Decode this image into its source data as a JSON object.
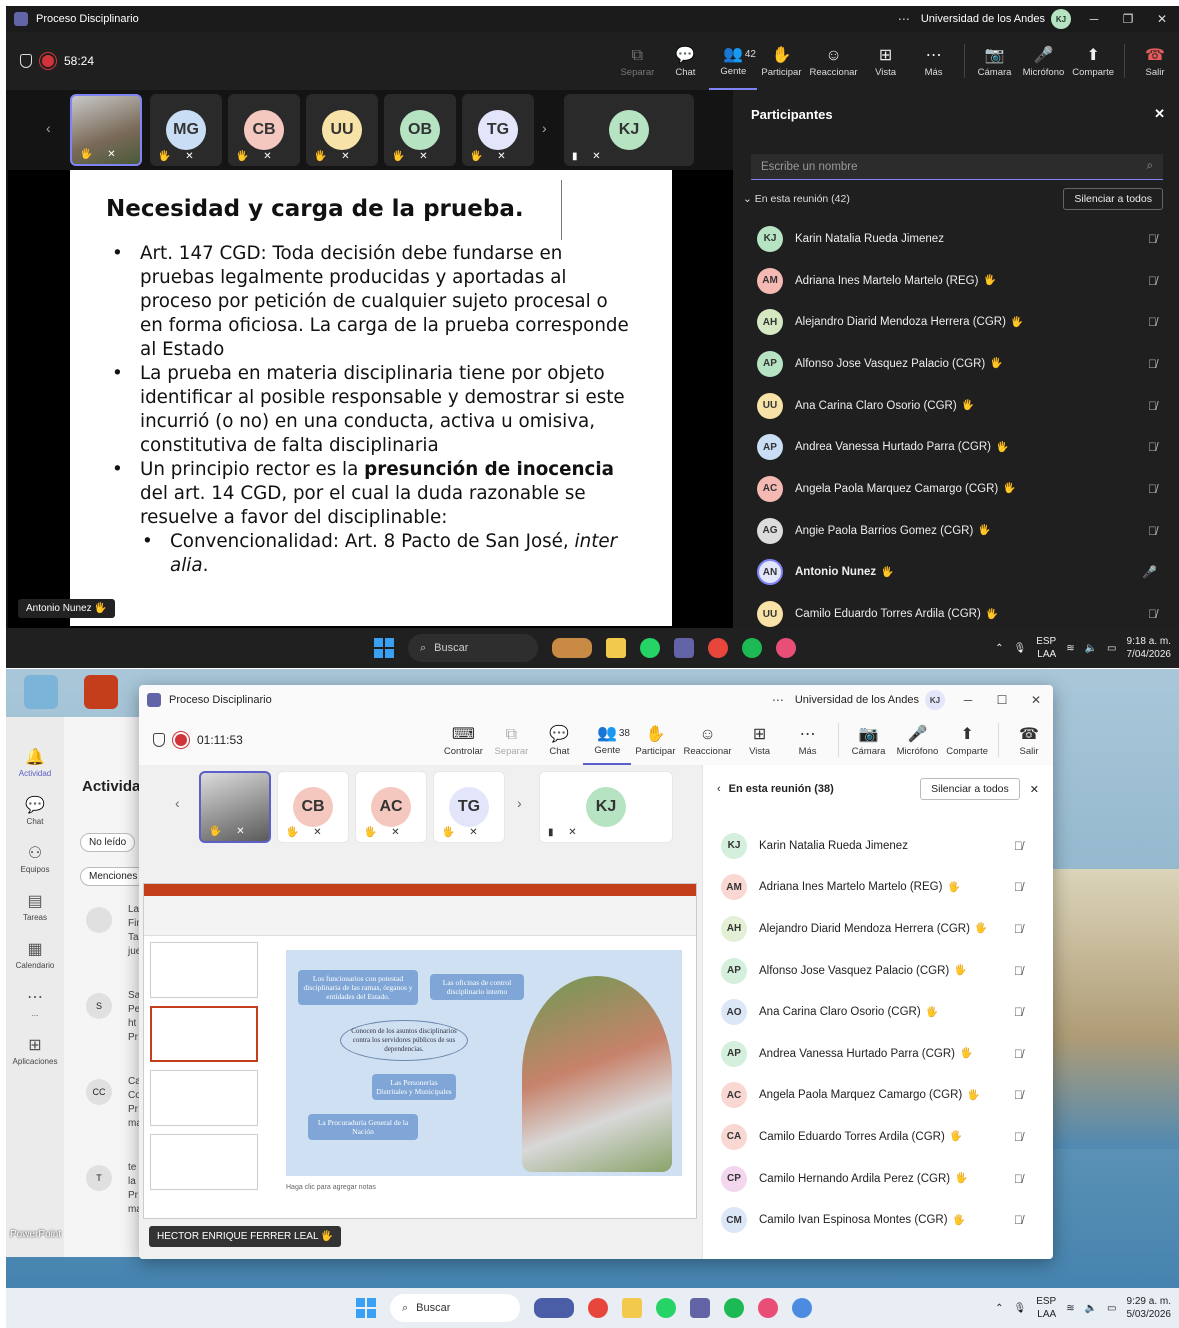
{
  "top": {
    "title": "Proceso Disciplinario",
    "org": "Universidad de los Andes",
    "org_badge": "KJ",
    "timer": "58:24",
    "tools": [
      {
        "label": "Separar",
        "icon": "⧉",
        "dim": true
      },
      {
        "label": "Chat",
        "icon": "💬"
      },
      {
        "label": "Gente",
        "icon": "👥",
        "count": "42",
        "active": true
      },
      {
        "label": "Participar",
        "icon": "✋"
      },
      {
        "label": "Reaccionar",
        "icon": "☺"
      },
      {
        "label": "Vista",
        "icon": "⊞"
      },
      {
        "label": "Más",
        "icon": "⋯"
      }
    ],
    "tools2": [
      {
        "label": "Cámara",
        "icon": "📷"
      },
      {
        "label": "Micrófono",
        "icon": "🎤"
      },
      {
        "label": "Comparte",
        "icon": "⬆"
      },
      {
        "label": "Salir",
        "icon": "☎"
      }
    ],
    "tiles": [
      "MG",
      "CB",
      "UU",
      "OB",
      "TG",
      "KJ"
    ],
    "slide": {
      "title": "Necesidad y carga de la prueba.",
      "b1": "Art. 147 CGD: Toda decisión debe fundarse en pruebas legalmente producidas y aportadas al proceso por petición de cualquier sujeto procesal o en forma oficiosa. La carga de la prueba corresponde al Estado",
      "b2": "La prueba en materia disciplinaria tiene por objeto identificar al posible responsable y demostrar si este incurrió (o no) en una conducta, activa u omisiva, constitutiva de falta disciplinaria",
      "b3a": "Un principio rector es la ",
      "b3b": "presunción de inocencia",
      "b3c": " del art. 14 CGD, por el cual la duda razonable se resuelve a favor del disciplinable:",
      "b4a": "Convencionalidad: Art. 8 Pacto de San José, ",
      "b4b": "inter alia",
      "b4c": "."
    },
    "presenter": "Antonio Nunez",
    "panel": {
      "title": "Participantes",
      "placeholder": "Escribe un nombre",
      "meeting": "En esta reunión (42)",
      "mute_all": "Silenciar a todos",
      "people": [
        {
          "i": "KJ",
          "n": "Karin Natalia Rueda Jimenez",
          "c": "#b6e3c2",
          "hand": false
        },
        {
          "i": "AM",
          "n": "Adriana Ines Martelo Martelo (REG)",
          "c": "#f4b9b2",
          "hand": true
        },
        {
          "i": "AH",
          "n": "Alejandro Diarid Mendoza Herrera (CGR)",
          "c": "#d6e8c2",
          "hand": true
        },
        {
          "i": "AP",
          "n": "Alfonso Jose Vasquez Palacio (CGR)",
          "c": "#b6e3c2",
          "hand": true
        },
        {
          "i": "UU",
          "n": "Ana Carina Claro Osorio (CGR)",
          "c": "#f7e3a8",
          "hand": true
        },
        {
          "i": "AP",
          "n": "Andrea Vanessa Hurtado Parra (CGR)",
          "c": "#c9def5",
          "hand": true
        },
        {
          "i": "AC",
          "n": "Angela Paola Marquez Camargo (CGR)",
          "c": "#f4b9b2",
          "hand": true
        },
        {
          "i": "AG",
          "n": "Angie Paola Barrios Gomez (CGR)",
          "c": "#dcdcdc",
          "hand": true
        },
        {
          "i": "AN",
          "n": "Antonio Nunez",
          "c": "#e3e6fb",
          "hand": true
        },
        {
          "i": "UU",
          "n": "Camilo Eduardo Torres Ardila (CGR)",
          "c": "#f7e3a8",
          "hand": true
        }
      ]
    },
    "taskbar": {
      "search": "Buscar",
      "lang1": "ESP",
      "lang2": "LAA",
      "time": "9:18 a. m.",
      "date": "7/04/2026"
    }
  },
  "bottom": {
    "title": "Proceso Disciplinario",
    "org": "Universidad de los Andes",
    "org_badge": "KJ",
    "timer": "01:11:53",
    "tools": [
      {
        "label": "Controlar",
        "icon": "⌨"
      },
      {
        "label": "Separar",
        "icon": "⧉",
        "dim": true
      },
      {
        "label": "Chat",
        "icon": "💬"
      },
      {
        "label": "Gente",
        "icon": "👥",
        "count": "38",
        "active": true
      },
      {
        "label": "Participar",
        "icon": "✋"
      },
      {
        "label": "Reaccionar",
        "icon": "☺"
      },
      {
        "label": "Vista",
        "icon": "⊞"
      },
      {
        "label": "Más",
        "icon": "⋯"
      }
    ],
    "tools2": [
      {
        "label": "Cámara",
        "icon": "📷"
      },
      {
        "label": "Micrófono",
        "icon": "🎤"
      },
      {
        "label": "Comparte",
        "icon": "⬆"
      },
      {
        "label": "Salir",
        "icon": "☎"
      }
    ],
    "tiles": [
      "CB",
      "AC",
      "TG",
      "KJ"
    ],
    "slide_boxes": {
      "a": "Los funcionarios con potestad disciplinaria de las ramas, órganos y entidades del Estado.",
      "b": "Las oficinas de control disciplinario interno",
      "c": "Conocen de los asuntos disciplinarios contra los servidores públicos de sus dependencias.",
      "d": "Las Personerías Distritales y Municipales",
      "e": "La Procuraduría General de la Nación"
    },
    "notes": "Haga clic para agregar notas",
    "presenter": "HECTOR ENRIQUE FERRER LEAL",
    "back": {
      "rail": [
        "Actividad",
        "Chat",
        "Equipos",
        "Tareas",
        "Calendario",
        "...",
        "Aplicaciones"
      ],
      "heading": "Activida",
      "chip1": "No leído",
      "chip2": "Menciones",
      "feed": [
        {
          "a": "",
          "t": "La\nFin\nTa\njue"
        },
        {
          "a": "S",
          "t": "Sa\nPe\nht\nPr"
        },
        {
          "a": "CC",
          "t": "Ca\nCo\nPr\nma"
        },
        {
          "a": "T",
          "t": "te\nla\nPr\nma"
        }
      ],
      "desk_label": "PowerPoint"
    },
    "panel": {
      "meeting": "En esta reunión (38)",
      "mute_all": "Silenciar a todos",
      "people": [
        {
          "i": "KJ",
          "n": "Karin Natalia Rueda Jimenez",
          "c": "#d4efdc",
          "hand": false
        },
        {
          "i": "AM",
          "n": "Adriana Ines Martelo Martelo (REG)",
          "c": "#f9d7d2",
          "hand": true
        },
        {
          "i": "AH",
          "n": "Alejandro Diarid Mendoza Herrera (CGR)",
          "c": "#e4f0d6",
          "hand": true
        },
        {
          "i": "AP",
          "n": "Alfonso Jose Vasquez Palacio (CGR)",
          "c": "#d4efdc",
          "hand": true
        },
        {
          "i": "AO",
          "n": "Ana Carina Claro Osorio (CGR)",
          "c": "#dbe7f7",
          "hand": true
        },
        {
          "i": "AP",
          "n": "Andrea Vanessa Hurtado Parra (CGR)",
          "c": "#d4efdc",
          "hand": true
        },
        {
          "i": "AC",
          "n": "Angela Paola Marquez Camargo (CGR)",
          "c": "#f9d7d2",
          "hand": true
        },
        {
          "i": "CA",
          "n": "Camilo Eduardo Torres Ardila (CGR)",
          "c": "#f9d7d2",
          "hand": true
        },
        {
          "i": "CP",
          "n": "Camilo Hernando Ardila Perez (CGR)",
          "c": "#f3d7ef",
          "hand": true
        },
        {
          "i": "CM",
          "n": "Camilo Ivan Espinosa Montes (CGR)",
          "c": "#dbe7f7",
          "hand": true
        }
      ]
    },
    "taskbar": {
      "search": "Buscar",
      "lang1": "ESP",
      "lang2": "LAA",
      "time": "9:29 a. m.",
      "date": "5/03/2026"
    }
  }
}
